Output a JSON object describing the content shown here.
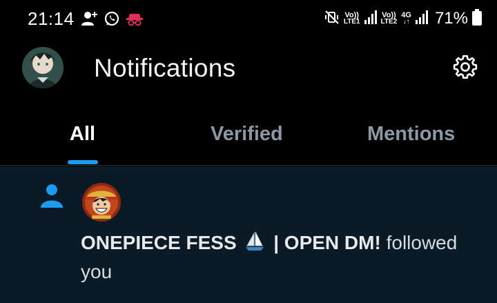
{
  "status_bar": {
    "time": "21:14",
    "left_icons": [
      "add-person-icon",
      "whatsapp-icon",
      "incognito-icon"
    ],
    "mute_icon": "vibrate-mute-icon",
    "sim1": {
      "top": "Vo))",
      "bottom": "LTE1"
    },
    "sim2": {
      "top": "Vo))",
      "bottom": "LTE2"
    },
    "network_type": "4G",
    "battery_percent": "71%"
  },
  "header": {
    "title": "Notifications",
    "settings_icon": "gear-icon"
  },
  "tabs": [
    {
      "label": "All",
      "active": true
    },
    {
      "label": "Verified",
      "active": false
    },
    {
      "label": "Mentions",
      "active": false
    }
  ],
  "notifications": [
    {
      "type": "follow",
      "icon": "person-icon",
      "user_name": "ONEPIECE FESS",
      "name_emoji": "sailboat-icon",
      "name_suffix": "| OPEN DM!",
      "action": "followed you"
    }
  ],
  "colors": {
    "background": "#000000",
    "accent": "#1d9bf0",
    "notification_bg": "#0a1a26",
    "muted_text": "#8b98a5"
  }
}
